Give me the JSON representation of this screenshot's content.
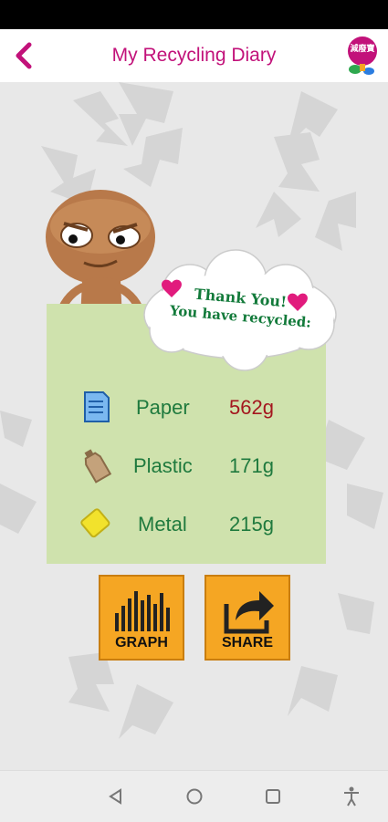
{
  "header": {
    "title": "My Recycling Diary",
    "logo_text": "減廢寶"
  },
  "bubble": {
    "line1": "Thank You!",
    "line2": "You have recycled:"
  },
  "items": [
    {
      "label": "Paper",
      "value": "562g",
      "icon": "paper-icon",
      "value_color": "#a4171f"
    },
    {
      "label": "Plastic",
      "value": "171g",
      "icon": "bottle-icon",
      "value_color": "#1f7a3e"
    },
    {
      "label": "Metal",
      "value": "215g",
      "icon": "can-icon",
      "value_color": "#1f7a3e"
    }
  ],
  "buttons": {
    "graph": "GRAPH",
    "share": "SHARE"
  },
  "colors": {
    "accent": "#c2127a",
    "card": "#cfe2ad",
    "button": "#f5a623",
    "text_green": "#1f7a3e"
  }
}
